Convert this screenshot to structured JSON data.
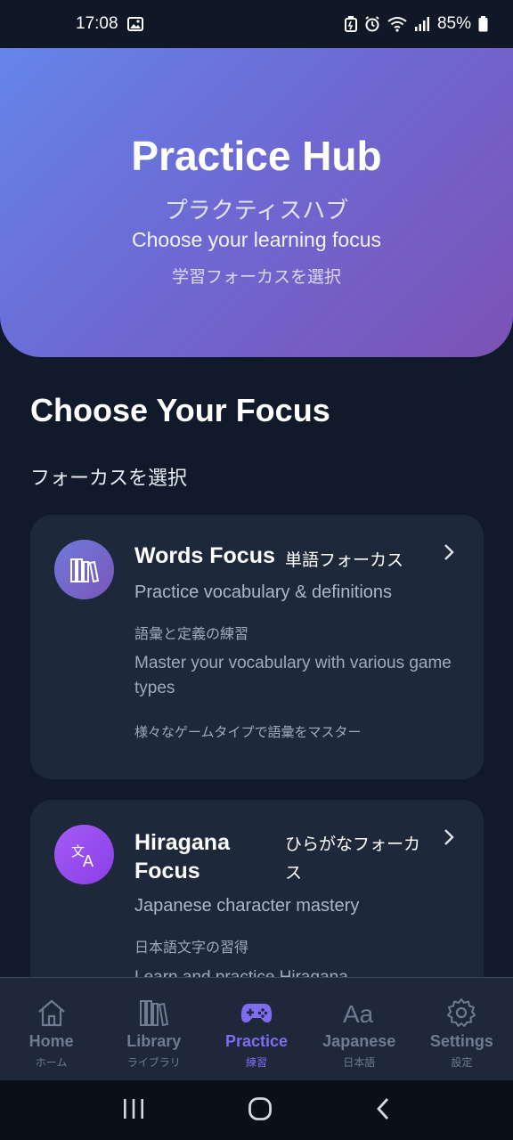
{
  "status_bar": {
    "time": "17:08",
    "battery": "85%",
    "icons": [
      "gallery-icon",
      "battery-saver-icon",
      "alarm-icon",
      "wifi-icon",
      "signal-icon",
      "battery-icon"
    ]
  },
  "hero": {
    "title": "Practice Hub",
    "subtitle_ja": "プラクティスハブ",
    "subtitle_en": "Choose your learning focus",
    "subtitle_ja2": "学習フォーカスを選択",
    "gradient": [
      "#6585ea",
      "#7c52b5"
    ]
  },
  "section": {
    "title": "Choose Your Focus",
    "subtitle": "フォーカスを選択"
  },
  "cards": [
    {
      "icon": "books-icon",
      "title": "Words Focus",
      "title_ja": "単語フォーカス",
      "description": "Practice vocabulary & definitions",
      "description_ja": "語彙と定義の練習",
      "long": "Master your vocabulary with various game types",
      "long_ja": "様々なゲームタイプで語彙をマスター"
    },
    {
      "icon": "translate-icon",
      "title": "Hiragana Focus",
      "title_ja": "ひらがなフォーカス",
      "description": "Japanese character mastery",
      "description_ja": "日本語文字の習得",
      "long": "Learn and practice Hiragana"
    }
  ],
  "bottom_nav": {
    "active": "Practice",
    "active_color": "#7f6cf1",
    "items": [
      {
        "label": "Home",
        "label_ja": "ホーム",
        "icon": "home-icon"
      },
      {
        "label": "Library",
        "label_ja": "ライブラリ",
        "icon": "library-icon"
      },
      {
        "label": "Practice",
        "label_ja": "練習",
        "icon": "gamepad-icon"
      },
      {
        "label": "Japanese",
        "label_ja": "日本語",
        "icon": "font-aa-icon"
      },
      {
        "label": "Settings",
        "label_ja": "設定",
        "icon": "gear-icon"
      }
    ]
  },
  "system_nav": [
    "recents-icon",
    "home-circle-icon",
    "back-icon"
  ]
}
